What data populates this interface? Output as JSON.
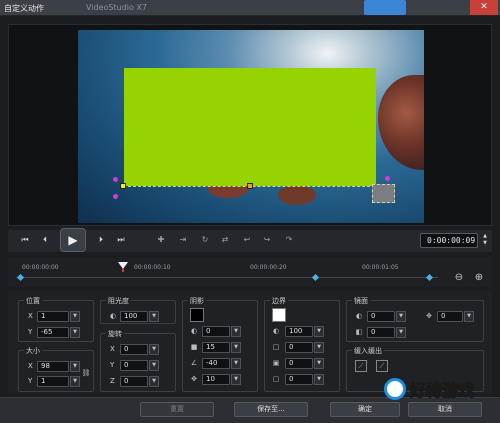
{
  "window": {
    "title": "自定义动作",
    "ghost_title": "VideoStudio X7"
  },
  "playback": {
    "timecode": "0:00:00:09"
  },
  "timeline": {
    "ticks": [
      "00:00:00:00",
      "00:00:00:10",
      "00:00:00:20",
      "00:00:01:05"
    ]
  },
  "position": {
    "label": "位置",
    "x_label": "X",
    "x_value": "1",
    "y_label": "Y",
    "y_value": "-65"
  },
  "size": {
    "label": "大小",
    "x_label": "X",
    "x_value": "98",
    "y_label": "Y",
    "y_value": "1"
  },
  "opacity": {
    "label": "阻光度",
    "value": "100"
  },
  "rotation": {
    "label": "旋转",
    "x_label": "X",
    "x_value": "0",
    "y_label": "Y",
    "y_value": "0",
    "z_label": "Z",
    "z_value": "0"
  },
  "shadow": {
    "label": "阴影",
    "color": "#000000",
    "opacity": "0",
    "blur": "15",
    "angle": "-40",
    "distance": "10"
  },
  "border": {
    "label": "边界",
    "color": "#ffffff",
    "opacity": "100",
    "v1": "0",
    "v2": "0",
    "v3": "0"
  },
  "mirror": {
    "label": "镜面",
    "opacity": "0",
    "blur": "0",
    "distance": "0"
  },
  "fade": {
    "label": "缓入缓出"
  },
  "footer": {
    "reset": "重置",
    "save": "保存至...",
    "ok": "确定",
    "cancel": "取消"
  },
  "watermark": {
    "text": "好特游戏"
  },
  "colors": {
    "object_fill": "#96d400",
    "keyframe": "#48b3e6",
    "accent": "#3b86d6"
  }
}
